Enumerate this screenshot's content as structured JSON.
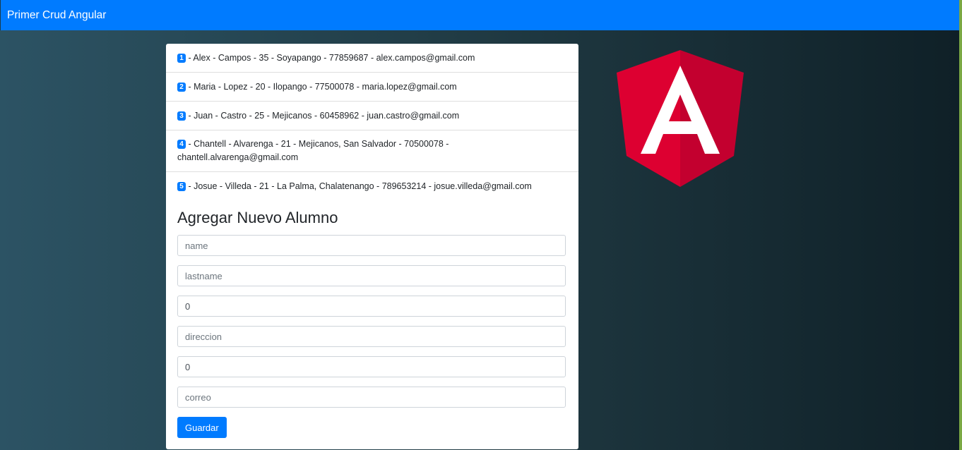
{
  "navbar": {
    "brand": "Primer Crud Angular"
  },
  "students": [
    {
      "id": "1",
      "text": " - Alex - Campos - 35 - Soyapango - 77859687 - alex.campos@gmail.com"
    },
    {
      "id": "2",
      "text": " - Maria - Lopez - 20 - Ilopango - 77500078 - maria.lopez@gmail.com"
    },
    {
      "id": "3",
      "text": " - Juan - Castro - 25 - Mejicanos - 60458962 - juan.castro@gmail.com"
    },
    {
      "id": "4",
      "text": " - Chantell - Alvarenga - 21 - Mejicanos, San Salvador - 70500078 - chantell.alvarenga@gmail.com"
    },
    {
      "id": "5",
      "text": " - Josue - Villeda - 21 - La Palma, Chalatenango - 789653214 - josue.villeda@gmail.com"
    }
  ],
  "form": {
    "title": "Agregar Nuevo Alumno",
    "fields": [
      {
        "placeholder": "name",
        "value": ""
      },
      {
        "placeholder": "lastname",
        "value": ""
      },
      {
        "placeholder": "",
        "value": "0"
      },
      {
        "placeholder": "direccion",
        "value": ""
      },
      {
        "placeholder": "",
        "value": "0"
      },
      {
        "placeholder": "correo",
        "value": ""
      }
    ],
    "submit_label": "Guardar"
  },
  "logo": {
    "icon": "angular-logo-icon",
    "letter": "A",
    "colors": {
      "left": "#dd0031",
      "right": "#c3002f",
      "letter": "#ffffff"
    }
  },
  "colors": {
    "primary": "#007bff",
    "accent_edge": "#7aa844"
  }
}
